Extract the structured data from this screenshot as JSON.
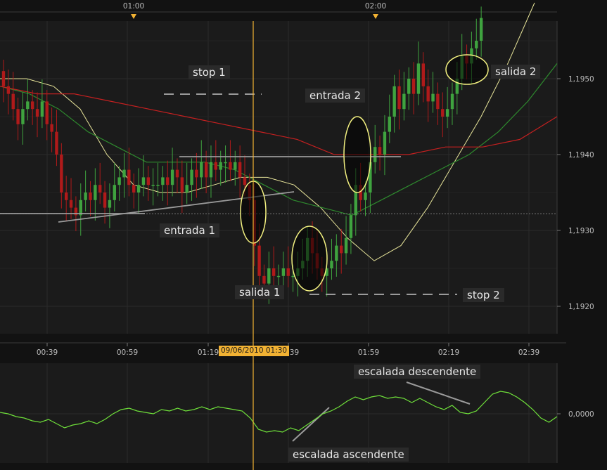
{
  "colors": {
    "background": "#121212",
    "panel": "#1b1b1b",
    "grid": "#2b2b2b",
    "candle_up": "#3fa33f",
    "candle_down": "#b01a1a",
    "ma_fast": "#e8e59a",
    "ma_mid": "#2e8a2e",
    "ma_slow": "#c62020",
    "indicator": "#6fe03a",
    "drawn_line": "#9a9a9a",
    "ellipse": "#f2f080",
    "cursor": "#f2b233"
  },
  "session_labels": [
    "01:00",
    "02:00"
  ],
  "cursor_label": "09/06/2010 01:30",
  "annotations": {
    "stop1": "stop 1",
    "entrada2": "entrada 2",
    "entrada1": "entrada 1",
    "salida1": "salida 1",
    "stop2": "stop 2",
    "salida2": "salida 2",
    "escalada_descendente": "escalada descendente",
    "escalada_ascendente": "escalada ascendente"
  },
  "chart_data": [
    {
      "type": "candlestick",
      "x_tick_labels": [
        "00:39",
        "00:59",
        "01:19",
        "01:39",
        "01:59",
        "02:19",
        "02:39"
      ],
      "y_tick_labels": [
        "1,1920",
        "1,1930",
        "1,1940",
        "1,1950"
      ],
      "ylim": [
        1.191,
        1.196
      ],
      "horizontal_level": 1.19322,
      "close_series": [
        1.1949,
        1.1948,
        1.1946,
        1.1944,
        1.1946,
        1.1947,
        1.1946,
        1.1945,
        1.1947,
        1.1944,
        1.1943,
        1.194,
        1.1935,
        1.1934,
        1.1933,
        1.1932,
        1.1934,
        1.1935,
        1.1934,
        1.1936,
        1.1935,
        1.1933,
        1.1934,
        1.1936,
        1.1937,
        1.1938,
        1.1936,
        1.1935,
        1.1936,
        1.1937,
        1.1936,
        1.1936,
        1.1936,
        1.1937,
        1.1936,
        1.1938,
        1.1937,
        1.1935,
        1.1936,
        1.1938,
        1.1937,
        1.1939,
        1.1937,
        1.1939,
        1.1938,
        1.1939,
        1.1939,
        1.1938,
        1.1939,
        1.1937,
        1.1936,
        1.1934,
        1.1928,
        1.1924,
        1.1923,
        1.1925,
        1.1924,
        1.1924,
        1.1925,
        1.1924,
        1.1924,
        1.1925,
        1.1926,
        1.1929,
        1.1927,
        1.1925,
        1.1924,
        1.1925,
        1.1926,
        1.1928,
        1.1927,
        1.1929,
        1.1932,
        1.1936,
        1.1934,
        1.1935,
        1.1939,
        1.1941,
        1.194,
        1.1943,
        1.1945,
        1.1949,
        1.1946,
        1.1948,
        1.195,
        1.1948,
        1.1952,
        1.1949,
        1.1947,
        1.1948,
        1.1946,
        1.1945,
        1.1946,
        1.1948,
        1.195,
        1.1953,
        1.1952,
        1.1954,
        1.1955,
        1.1958
      ],
      "series": [
        {
          "type": "moving-average-fast",
          "values": [
            1.195,
            1.195,
            1.1949,
            1.1946,
            1.194,
            1.1936,
            1.1935,
            1.1935,
            1.1936,
            1.1937,
            1.1937,
            1.1936,
            1.1933,
            1.1929,
            1.1926,
            1.1928,
            1.1933,
            1.1939,
            1.1945,
            1.1952,
            1.196
          ]
        },
        {
          "type": "moving-average-mid",
          "values": [
            1.1949,
            1.1948,
            1.1946,
            1.1943,
            1.1941,
            1.1939,
            1.1939,
            1.1939,
            1.1938,
            1.1936,
            1.1934,
            1.1933,
            1.1932,
            1.1934,
            1.1936,
            1.1938,
            1.194,
            1.1943,
            1.1947,
            1.1952
          ]
        },
        {
          "type": "moving-average-slow",
          "values": [
            1.1949,
            1.1948,
            1.1948,
            1.1947,
            1.1946,
            1.1945,
            1.1944,
            1.1943,
            1.1942,
            1.194,
            1.194,
            1.194,
            1.1941,
            1.1941,
            1.1942,
            1.1945
          ]
        }
      ]
    },
    {
      "type": "line",
      "y_tick_labels": [
        "0,0000"
      ],
      "values": [
        0.1,
        0.0,
        -0.2,
        -0.3,
        -0.5,
        -0.6,
        -0.4,
        -0.7,
        -1.0,
        -0.8,
        -0.7,
        -0.5,
        -0.7,
        -0.4,
        0.0,
        0.3,
        0.4,
        0.2,
        0.1,
        0.0,
        0.3,
        0.2,
        0.4,
        0.2,
        0.3,
        0.5,
        0.3,
        0.5,
        0.4,
        0.3,
        0.2,
        -0.3,
        -1.1,
        -1.3,
        -1.2,
        -1.3,
        -1.0,
        -1.2,
        -0.8,
        -0.4,
        0.0,
        0.2,
        0.5,
        0.9,
        1.2,
        1.0,
        1.2,
        1.3,
        1.1,
        1.2,
        1.1,
        0.8,
        1.1,
        0.8,
        0.5,
        0.3,
        0.6,
        0.1,
        0.0,
        0.2,
        0.8,
        1.4,
        1.6,
        1.5,
        1.2,
        0.8,
        0.3,
        -0.3,
        -0.6,
        -0.2
      ]
    }
  ]
}
